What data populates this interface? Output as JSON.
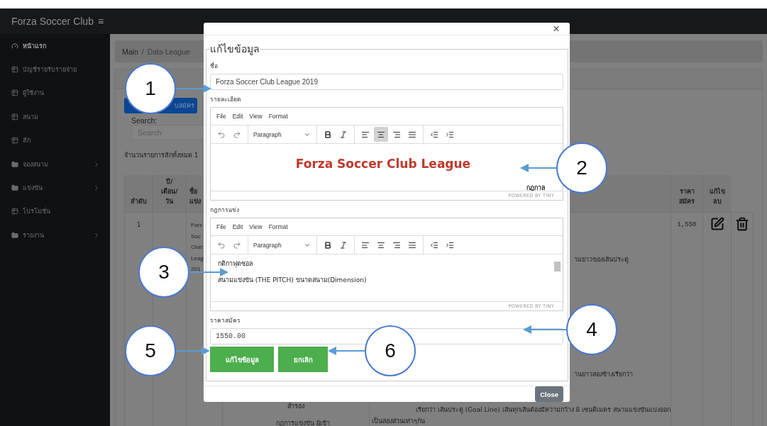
{
  "app": {
    "title": "Forza Soccer Club",
    "menu_icon": "≡"
  },
  "sidebar": {
    "items": [
      {
        "label": "หน้าแรก",
        "kind": "dashboard",
        "selected": true,
        "has_submenu": false
      },
      {
        "label": "บัญชีรายรับรายจ่าย",
        "kind": "table",
        "selected": false,
        "has_submenu": false
      },
      {
        "label": "ผู้ใช้งาน",
        "kind": "table",
        "selected": false,
        "has_submenu": false
      },
      {
        "label": "สนาม",
        "kind": "table",
        "selected": false,
        "has_submenu": false
      },
      {
        "label": "ลีก",
        "kind": "table",
        "selected": false,
        "has_submenu": false
      },
      {
        "label": "จองสนาม",
        "kind": "folder",
        "selected": false,
        "has_submenu": true
      },
      {
        "label": "แข่งขัน",
        "kind": "folder",
        "selected": false,
        "has_submenu": true
      },
      {
        "label": "โปรโมชั่น",
        "kind": "table",
        "selected": false,
        "has_submenu": false
      },
      {
        "label": "รายงาน",
        "kind": "folder",
        "selected": false,
        "has_submenu": true
      }
    ]
  },
  "breadcrumb": {
    "items": [
      "Main",
      "Data League"
    ],
    "separator": "/"
  },
  "add_button": "บสมัคร",
  "search": {
    "label": "Search:",
    "placeholder": "Search"
  },
  "summary": "จำนวนรายการลีกทั้งหมด 1",
  "table": {
    "columns": [
      "ลำดับ",
      "ปี/ เดือน/ วัน",
      "ชื่อ แข่ง",
      "ราคา สมัคร",
      "แก้ไข ลบ"
    ],
    "rows": [
      {
        "index": "1",
        "name_lines": [
          "Forz",
          "Soc",
          "Club",
          "Leag",
          "201"
        ],
        "column_4": [
          "สำรอง",
          "กฎการแข่งขัน ผู้เข้า"
        ],
        "column_5": [
          "ามยาวของเส้นประตู",
          "านยาวสองข้างเรียกว่า",
          "เรียกว่า เส้นประตู (Goal Line) เส้นทุกเส้นต้องมีความกว้าง 8 เซนติเมตร สนามแข่งขันแบ่งออก",
          "เป็นสองส่วนเท่าๆกัน"
        ],
        "price": "1,550"
      }
    ]
  },
  "modal": {
    "close_icon": "×",
    "legend": "แก้ไขข้อมูล",
    "name": {
      "label": "ชื่อ",
      "value": "Forza Soccer Club League 2019"
    },
    "editors": [
      {
        "label": "รายละเอียด",
        "menu": [
          "File",
          "Edit",
          "View",
          "Format"
        ],
        "block_format": "Paragraph",
        "tools": [
          {
            "kind": "bold",
            "selected": false
          },
          {
            "kind": "italic",
            "selected": false
          },
          {
            "kind": "align-left",
            "selected": false
          },
          {
            "kind": "align-center",
            "selected": true
          },
          {
            "kind": "align-right",
            "selected": false
          },
          {
            "kind": "align-justify",
            "selected": false
          }
        ],
        "content": [
          {
            "kind": "heading",
            "text": "Forza Soccer Club League"
          },
          {
            "kind": "cut",
            "text": "กฎกาล"
          }
        ],
        "footer": "POWERED BY TINY"
      },
      {
        "label": "กฎการแข่ง",
        "menu": [
          "File",
          "Edit",
          "View",
          "Format"
        ],
        "block_format": "Paragraph",
        "tools": [
          {
            "kind": "bold",
            "selected": false
          },
          {
            "kind": "italic",
            "selected": false
          },
          {
            "kind": "align-left",
            "selected": false
          },
          {
            "kind": "align-center",
            "selected": false
          },
          {
            "kind": "align-right",
            "selected": false
          },
          {
            "kind": "align-justify",
            "selected": false
          }
        ],
        "content": [
          {
            "kind": "paragraph",
            "text": "กติกาฟุตซอล"
          },
          {
            "kind": "paragraph",
            "text": "สนามแข่งขัน (THE PITCH) ขนาดสนาม(Dimension)"
          }
        ],
        "footer": "POWERED BY TINY"
      }
    ],
    "price": {
      "label": "ราคาสมัคร",
      "value": "1550.00"
    },
    "buttons": [
      "แก้ไขข้อมูล",
      "ยกเลิก"
    ],
    "close_button": "Close"
  },
  "callouts": [
    "1",
    "2",
    "3",
    "4",
    "5",
    "6"
  ]
}
